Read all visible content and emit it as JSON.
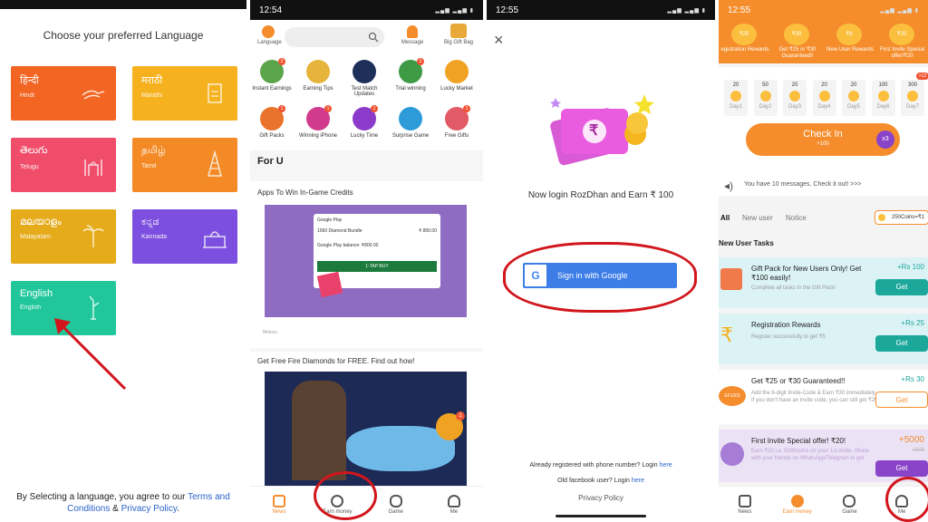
{
  "pane1": {
    "heading": "Choose your preferred Language",
    "langs": [
      {
        "native": "हिन्दी",
        "english": "Hindi",
        "color": "#f26522"
      },
      {
        "native": "मराठी",
        "english": "Marathi",
        "color": "#f5b11e"
      },
      {
        "native": "తెలుగు",
        "english": "Telugu",
        "color": "#ef4d6a"
      },
      {
        "native": "தமிழ்",
        "english": "Tamil",
        "color": "#f48a26"
      },
      {
        "native": "മലയാളം",
        "english": "Malayalam",
        "color": "#e5ab1b"
      },
      {
        "native": "ಕನ್ನಡ",
        "english": "Kannada",
        "color": "#7c4fe0"
      },
      {
        "native": "English",
        "english": "English",
        "color": "#21c79a"
      }
    ],
    "footer_prefix": "By Selecting a language, you agree to our",
    "terms": "Terms and Conditions",
    "amp": "&",
    "privacy": "Privacy Policy",
    "period": "."
  },
  "pane2": {
    "time": "12:54",
    "language": "Language",
    "message": "Message",
    "bigbag": "Big Gift Bag",
    "cats": [
      "Instant Earnings",
      "Earning Tips",
      "Test Match Updates",
      "Trial winning",
      "Lucky Market",
      "Gift Packs",
      "Winning iPhone",
      "Lucky Time",
      "Surprise Game",
      "Free Gifts"
    ],
    "cat_badges": [
      "2",
      "",
      "",
      "2",
      "",
      "1",
      "1",
      "1",
      "",
      "1"
    ],
    "foru": "For U",
    "card1_title": "Apps To Win In-Game Credits",
    "gp_label": "Google Play",
    "gp_item": "1060 Diamond Bundle",
    "gp_price": "₹ 800.00",
    "gp_balance": "Google Play balance: ₹800.00",
    "gp_buy": "1-TAP BUY",
    "card1_source": "Moloco",
    "card2_title": "Get Free Fire Diamonds for FREE. Find out how!",
    "card2_badge": "1",
    "nav": [
      "News",
      "Earn money",
      "Game",
      "Me"
    ]
  },
  "pane3": {
    "time": "12:55",
    "close": "×",
    "rupee": "₹",
    "login_text": "Now login RozDhan and Earn ₹ 100",
    "google_btn": "Sign in with Google",
    "already": "Already registered with phone number? Login",
    "already_link": "here",
    "fb": "Old facebook user? Login",
    "fb_link": "here",
    "privacy": "Privacy Policy"
  },
  "pane4": {
    "time": "12:55",
    "reward_coins": [
      "₹25",
      "₹30",
      "₹8",
      "₹20"
    ],
    "rewards": [
      "egistration Rewards",
      "Get ₹25 or ₹30 Guaranteed!!",
      "New User Rewards",
      "First Invite Special offer!₹20"
    ],
    "checkin_values": [
      "20",
      "50",
      "20",
      "20",
      "20",
      "100",
      "300"
    ],
    "checkin_days": [
      "Day1",
      "Day2",
      "Day3",
      "Day4",
      "Day5",
      "Day6",
      "Day7"
    ],
    "checkin_badge": "×12",
    "checkin": "Check In",
    "checkin_sub": "+100",
    "x3": "x3",
    "messages": "You have 10 messages. Check it out! >>>",
    "tabs": [
      "All",
      "New user",
      "Notice"
    ],
    "coins_pill": "250Coins=₹1",
    "section": "New User Tasks",
    "tasks": [
      {
        "title": "Gift Pack for New Users Only! Get ₹100 easily!",
        "desc": "Complete all tasks in the Gift Pack!",
        "reward": "+Rs 100",
        "btn": "Get"
      },
      {
        "title": "Registration Rewards",
        "desc": "Register successfully to get ₹5",
        "reward": "+Rs 25",
        "btn": "Get"
      },
      {
        "title": "Get ₹25 or ₹30 Guaranteed!!",
        "desc": "Add the 6-digit Invite-Code & Earn ₹30 immediately. If you don't have an invite code, you can still get ₹25",
        "reward": "+Rs 30",
        "btn": "Get"
      },
      {
        "title": "First Invite Special offer! ₹20!",
        "desc": "Earn ₹20 i.e. 5000coins on your 1st invite. Share with your friends on WhatsApp/Telegram to get",
        "reward": "+5000",
        "btn": "Get"
      }
    ],
    "task3_code": "EFJ200",
    "strike_value": "4000",
    "nav": [
      "News",
      "Earn money",
      "Game",
      "Me"
    ]
  }
}
